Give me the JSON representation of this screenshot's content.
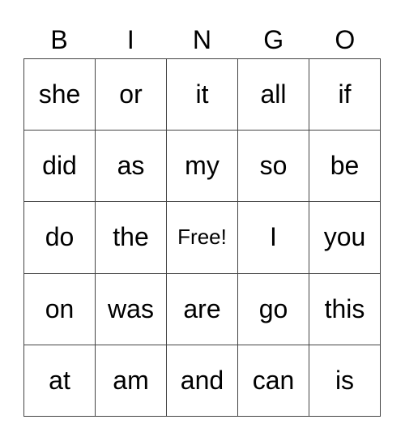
{
  "header": [
    "B",
    "I",
    "N",
    "G",
    "O"
  ],
  "cells": [
    [
      "she",
      "or",
      "it",
      "all",
      "if"
    ],
    [
      "did",
      "as",
      "my",
      "so",
      "be"
    ],
    [
      "do",
      "the",
      "Free!",
      "I",
      "you"
    ],
    [
      "on",
      "was",
      "are",
      "go",
      "this"
    ],
    [
      "at",
      "am",
      "and",
      "can",
      "is"
    ]
  ]
}
